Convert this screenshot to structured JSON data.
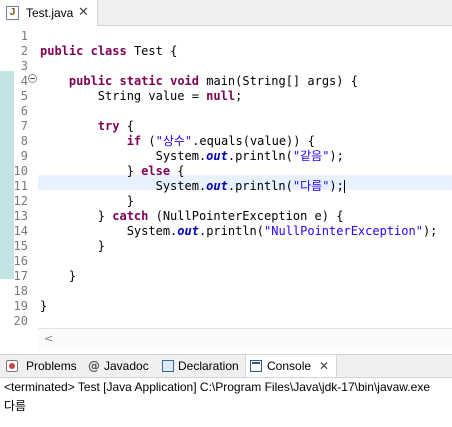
{
  "editor_tab": {
    "label": "Test.java",
    "icon": "java-file-icon",
    "close": "✕"
  },
  "line_numbers": [
    "1",
    "2",
    "3",
    "4",
    "5",
    "6",
    "7",
    "8",
    "9",
    "10",
    "11",
    "12",
    "13",
    "14",
    "15",
    "16",
    "17",
    "18",
    "19",
    "20"
  ],
  "code": [
    [],
    [
      [
        "kw",
        "public"
      ],
      [
        "t",
        " "
      ],
      [
        "kw",
        "class"
      ],
      [
        "t",
        " Test {"
      ]
    ],
    [],
    [
      [
        "t",
        "    "
      ],
      [
        "kw",
        "public"
      ],
      [
        "t",
        " "
      ],
      [
        "kw",
        "static"
      ],
      [
        "t",
        " "
      ],
      [
        "kw",
        "void"
      ],
      [
        "t",
        " main(String[] args) {"
      ]
    ],
    [
      [
        "t",
        "        String value = "
      ],
      [
        "kw",
        "null"
      ],
      [
        "t",
        ";"
      ]
    ],
    [],
    [
      [
        "t",
        "        "
      ],
      [
        "kw",
        "try"
      ],
      [
        "t",
        " {"
      ]
    ],
    [
      [
        "t",
        "            "
      ],
      [
        "kw",
        "if"
      ],
      [
        "t",
        " ("
      ],
      [
        "str",
        "\"상수\""
      ],
      [
        "t",
        ".equals(value)) {"
      ]
    ],
    [
      [
        "t",
        "                System."
      ],
      [
        "fld",
        "out"
      ],
      [
        "t",
        ".println("
      ],
      [
        "str",
        "\"같음\""
      ],
      [
        "t",
        ");"
      ]
    ],
    [
      [
        "t",
        "            } "
      ],
      [
        "kw",
        "else"
      ],
      [
        "t",
        " {"
      ]
    ],
    [
      [
        "t",
        "                System."
      ],
      [
        "fld",
        "out"
      ],
      [
        "t",
        ".println("
      ],
      [
        "str",
        "\"다름\""
      ],
      [
        "t",
        ");"
      ],
      [
        "caret",
        ""
      ]
    ],
    [
      [
        "t",
        "            }"
      ]
    ],
    [
      [
        "t",
        "        } "
      ],
      [
        "kw",
        "catch"
      ],
      [
        "t",
        " (NullPointerException e) {"
      ]
    ],
    [
      [
        "t",
        "            System."
      ],
      [
        "fld",
        "out"
      ],
      [
        "t",
        ".println("
      ],
      [
        "str",
        "\"NullPointerException\""
      ],
      [
        "t",
        ");"
      ]
    ],
    [
      [
        "t",
        "        }"
      ]
    ],
    [],
    [
      [
        "t",
        "    }"
      ]
    ],
    [],
    [
      [
        "t",
        "}"
      ]
    ],
    []
  ],
  "panel_tabs": [
    {
      "label": "Problems",
      "icon": "problems-icon"
    },
    {
      "label": "Javadoc",
      "icon": "javadoc-icon",
      "glyph": "@"
    },
    {
      "label": "Declaration",
      "icon": "declaration-icon"
    },
    {
      "label": "Console",
      "icon": "console-icon",
      "close": "✕",
      "active": true
    }
  ],
  "console": {
    "status": "<terminated> Test [Java Application] C:\\Program Files\\Java\\jdk-17\\bin\\javaw.exe",
    "output": "다름"
  }
}
